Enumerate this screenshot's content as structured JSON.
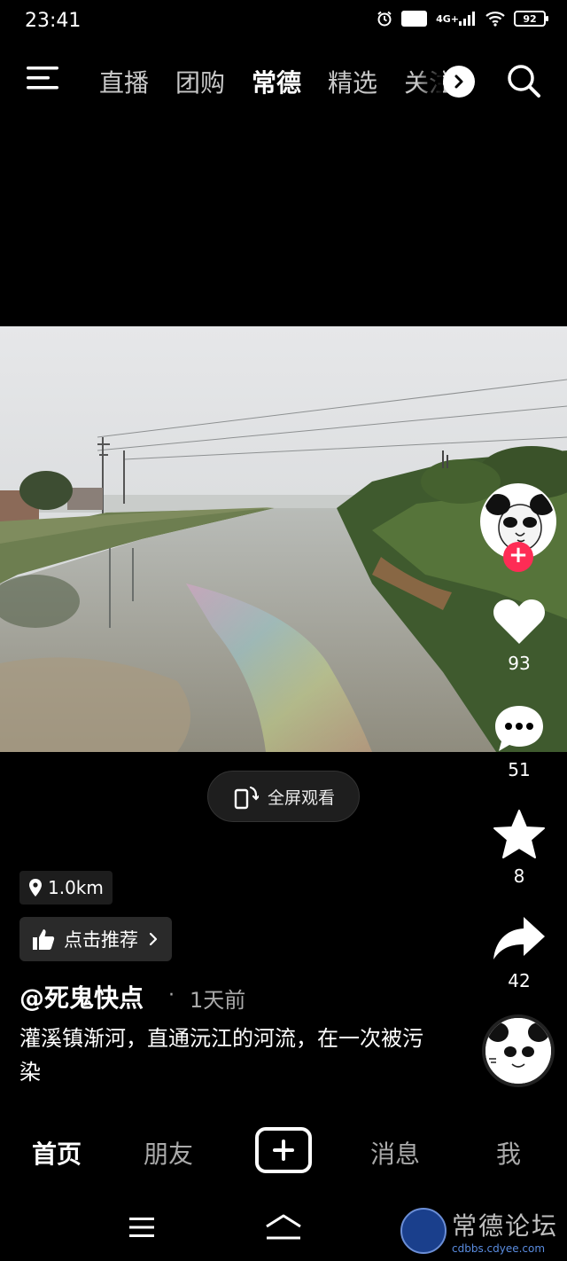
{
  "status_bar": {
    "time": "23:41",
    "network": "4G+",
    "hd": "HD",
    "battery": "92",
    "icons": [
      "alarm-icon",
      "hd-icon",
      "signal-icon",
      "wifi-icon",
      "battery-icon"
    ]
  },
  "top_nav": {
    "menu_icon": "hamburger-menu-icon",
    "tabs": [
      {
        "label": "直播",
        "active": false
      },
      {
        "label": "团购",
        "active": false
      },
      {
        "label": "常德",
        "active": true
      },
      {
        "label": "精选",
        "active": false
      },
      {
        "label": "关注",
        "active": false
      }
    ],
    "more_icon": "chevron-right-icon",
    "search_icon": "search-icon"
  },
  "video": {
    "fullscreen_label": "全屏观看",
    "fullscreen_icon": "rotate-screen-icon"
  },
  "rail": {
    "follow_icon": "plus-icon",
    "like_count": "93",
    "comment_count": "51",
    "favorite_count": "8",
    "share_count": "42"
  },
  "info": {
    "location": "1.0km",
    "recommend_label": "点击推荐",
    "author": "@死鬼快点",
    "dot": "·",
    "time_ago": "1天前",
    "caption": "灌溪镇渐河，直通沅江的河流，在一次被污染"
  },
  "tabbar": {
    "tabs": [
      {
        "label": "首页",
        "active": true
      },
      {
        "label": "朋友",
        "active": false
      },
      {
        "label": "消息",
        "active": false
      },
      {
        "label": "我",
        "active": false
      }
    ],
    "create_icon": "plus-icon"
  },
  "watermark": {
    "title": "常德论坛",
    "url": "cdbbs.cdyee.com"
  },
  "colors": {
    "background": "#000000",
    "accent": "#fe2c55",
    "text": "#ffffff",
    "muted": "#aaaaaa"
  }
}
